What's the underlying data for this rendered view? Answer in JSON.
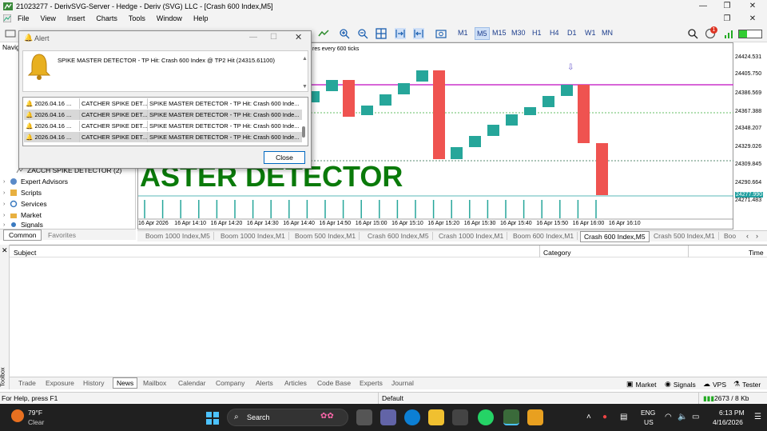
{
  "window": {
    "title": "21023277 - DerivSVG-Server - Hedge - Deriv (SVG) LLC - [Crash 600 Index,M5]"
  },
  "menu": [
    "File",
    "View",
    "Insert",
    "Charts",
    "Tools",
    "Window",
    "Help"
  ],
  "timeframes": [
    "M1",
    "M5",
    "M15",
    "M30",
    "H1",
    "H4",
    "D1",
    "W1",
    "MN"
  ],
  "active_timeframe": "M5",
  "notification_count": "1",
  "navigator": {
    "title": "Navig",
    "items": [
      "ZACCH SPIKE DETECTOR (2)",
      "Expert Advisors",
      "Scripts",
      "Services",
      "Market",
      "Signals"
    ],
    "tabs": [
      "Common",
      "Favorites"
    ]
  },
  "chart": {
    "info_text": "res every 600 ticks",
    "watermark": "ASTER DETECTOR",
    "price_labels": [
      "24424.531",
      "24405.750",
      "24386.569",
      "24367.388",
      "24348.207",
      "24329.026",
      "24309.845",
      "24290.664",
      "24277.990",
      "24271.483"
    ],
    "current_price": "24277.990",
    "time_labels": [
      "16 Apr 2026",
      "16 Apr 14:10",
      "16 Apr 14:20",
      "16 Apr 14:30",
      "16 Apr 14:40",
      "16 Apr 14:50",
      "16 Apr 15:00",
      "16 Apr 15:10",
      "16 Apr 15:20",
      "16 Apr 15:30",
      "16 Apr 15:40",
      "16 Apr 15:50",
      "16 Apr 16:00",
      "16 Apr 16:10"
    ],
    "bull_color": "#26a69a",
    "bear_color": "#ef5350",
    "line_color": "#cc33cc"
  },
  "chart_tabs": [
    "Boom 1000 Index,M5",
    "Boom 1000 Index,M1",
    "Boom 500 Index,M1",
    "Crash 600 Index,M5",
    "Crash 1000 Index,M1",
    "Boom 600 Index,M1",
    "Crash 600 Index,M5",
    "Crash 500 Index,M1",
    "Boo"
  ],
  "active_chart_tab": "Crash 600 Index,M5",
  "toolbox": {
    "side_label": "Toolbox",
    "headers": [
      "Subject",
      "Category",
      "Time"
    ],
    "tabs": [
      "Trade",
      "Exposure",
      "History",
      "News",
      "Mailbox",
      "Calendar",
      "Company",
      "Alerts",
      "Articles",
      "Code Base",
      "Experts",
      "Journal"
    ],
    "active_tab": "News",
    "right_links": [
      "Market",
      "Signals",
      "VPS",
      "Tester"
    ]
  },
  "status": {
    "help": "For Help, press F1",
    "profile": "Default",
    "traffic": "2673 / 8 Kb"
  },
  "alert": {
    "title": "Alert",
    "message": "SPIKE MASTER DETECTOR - TP Hit: Crash 600 Index  @ TP2 Hit (24315.61100)",
    "rows": [
      {
        "date": "2026.04.16 ...",
        "name": "CATCHER SPIKE DET...",
        "text": "SPIKE MASTER DETECTOR - TP Hit: Crash 600 Inde..."
      },
      {
        "date": "2026.04.16 ...",
        "name": "CATCHER SPIKE DET...",
        "text": "SPIKE MASTER DETECTOR - TP Hit: Crash 600 Inde..."
      },
      {
        "date": "2026.04.16 ...",
        "name": "CATCHER SPIKE DET...",
        "text": "SPIKE MASTER DETECTOR - TP Hit: Crash 600 Inde..."
      },
      {
        "date": "2026.04.16 ...",
        "name": "CATCHER SPIKE DET...",
        "text": "SPIKE MASTER DETECTOR - TP Hit: Crash 600 Inde..."
      }
    ],
    "close_label": "Close"
  },
  "taskbar": {
    "weather_temp": "79°F",
    "weather_desc": "Clear",
    "search_label": "Search",
    "lang": "ENG",
    "region": "US",
    "time": "6:13 PM",
    "date": "4/16/2026"
  }
}
